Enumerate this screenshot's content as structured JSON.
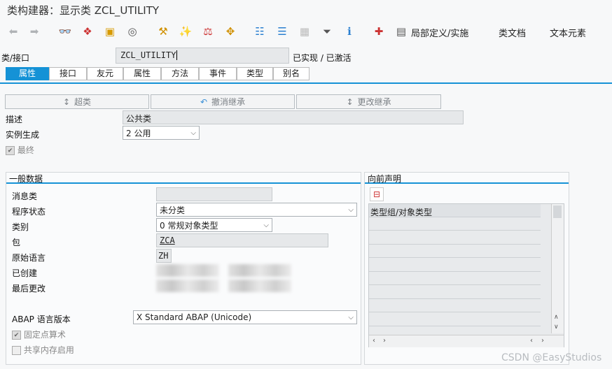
{
  "window": {
    "title": "类构建器：显示类 ZCL_UTILITY"
  },
  "toolbar": {
    "local_def_label": "局部定义/实施",
    "class_doc_label": "类文档",
    "text_elements_label": "文本元素"
  },
  "header": {
    "class_label": "类/接口",
    "class_value": "ZCL_UTILITY",
    "status": "已实现 / 已激活"
  },
  "tabs": [
    "属性",
    "接口",
    "友元",
    "属性",
    "方法",
    "事件",
    "类型",
    "别名"
  ],
  "actions": {
    "superclass": "超类",
    "undo_inherit": "撤消继承",
    "change_inherit": "更改继承"
  },
  "attributes": {
    "desc_label": "描述",
    "desc_value": "公共类",
    "inst_label": "实例生成",
    "inst_value": "2 公用",
    "final_label": "最终"
  },
  "general": {
    "title": "一般数据",
    "msg_class_label": "消息类",
    "program_status_label": "程序状态",
    "program_status_value": "未分类",
    "category_label": "类别",
    "category_value": "0 常规对象类型",
    "package_label": "包",
    "package_value": "ZCA",
    "orig_lang_label": "原始语言",
    "orig_lang_value": "ZH",
    "created_label": "已创建",
    "last_changed_label": "最后更改",
    "abap_version_label": "ABAP 语言版本",
    "abap_version_value": "X Standard ABAP (Unicode)",
    "fixed_point_label": "固定点算术",
    "shared_memory_label": "共享内存启用"
  },
  "forward": {
    "title": "向前声明",
    "column_header": "类型组/对象类型"
  },
  "watermark": "CSDN @EasyStudios"
}
